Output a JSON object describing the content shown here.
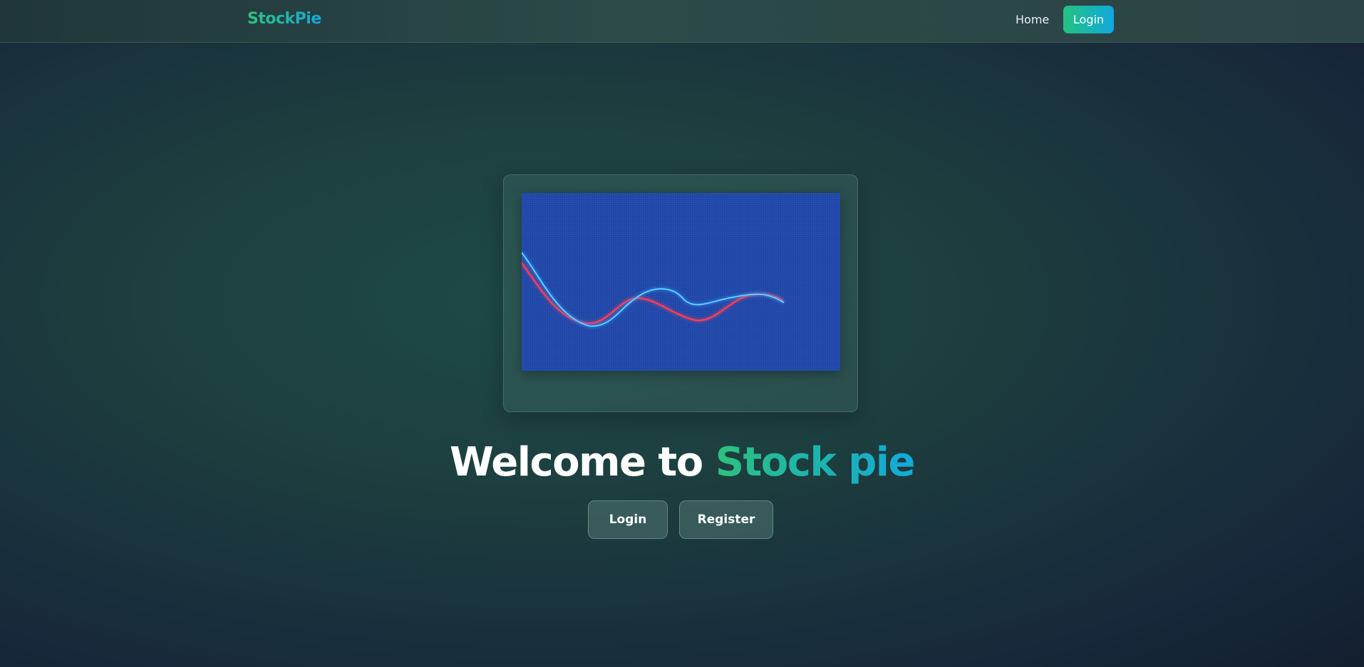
{
  "nav": {
    "brand": "StockPie",
    "home_label": "Home",
    "login_label": "Login"
  },
  "hero": {
    "headline_prefix": "Welcome to ",
    "headline_highlight": "Stock pie",
    "login_button": "Login",
    "register_button": "Register"
  },
  "colors": {
    "accent_green": "#2ec27e",
    "accent_blue": "#15a8d9",
    "chart_background": "#1d45a8",
    "line_blue": "#2aa8ff",
    "line_red": "#ff3d57"
  }
}
